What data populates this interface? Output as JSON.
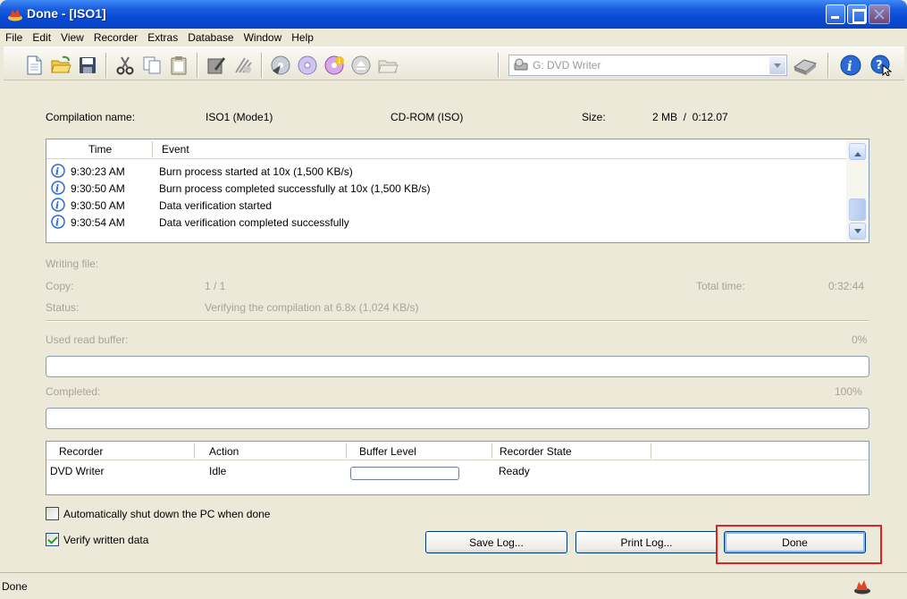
{
  "window": {
    "title": "Done - [ISO1]"
  },
  "menu": [
    "File",
    "Edit",
    "View",
    "Recorder",
    "Extras",
    "Database",
    "Window",
    "Help"
  ],
  "toolbar": {
    "drive_label": "G: DVD Writer",
    "icons": [
      "new-icon",
      "open-icon",
      "save-icon",
      "cut-icon",
      "copy-icon",
      "paste-icon",
      "edit-icon",
      "erase-icon",
      "burn-icon",
      "disc-icon",
      "disc-info-icon",
      "eject-icon",
      "folder-icon",
      "drive-icon",
      "recorder-icon",
      "info-icon",
      "help-icon"
    ]
  },
  "compilation": {
    "name_label": "Compilation name:",
    "name_value": "ISO1 (Mode1)",
    "type": "CD-ROM (ISO)",
    "size_label": "Size:",
    "size_value": "2 MB  /  0:12.07"
  },
  "log": {
    "headers": {
      "time": "Time",
      "event": "Event"
    },
    "rows": [
      {
        "time": "9:30:23 AM",
        "event": "Burn process started at 10x (1,500 KB/s)"
      },
      {
        "time": "9:30:50 AM",
        "event": "Burn process completed successfully at 10x (1,500 KB/s)"
      },
      {
        "time": "9:30:50 AM",
        "event": "Data verification started"
      },
      {
        "time": "9:30:54 AM",
        "event": "Data verification completed successfully"
      }
    ]
  },
  "status": {
    "writing_label": "Writing file:",
    "copy_label": "Copy:",
    "copy_value": "1 / 1",
    "total_time_label": "Total time:",
    "total_time_value": "0:32:44",
    "status_label": "Status:",
    "status_value": "Verifying the compilation at 6.8x (1,024 KB/s)",
    "buffer_label": "Used read buffer:",
    "buffer_value": "0%",
    "buffer_fraction": 0,
    "completed_label": "Completed:",
    "completed_value": "100%",
    "completed_fraction": 1
  },
  "recorder": {
    "headers": {
      "recorder": "Recorder",
      "action": "Action",
      "buffer": "Buffer Level",
      "state": "Recorder State"
    },
    "row": {
      "recorder": "DVD Writer",
      "action": "Idle",
      "buffer_fraction": 0,
      "state": "Ready"
    }
  },
  "options": {
    "shutdown_label": "Automatically shut down the PC when done",
    "shutdown_checked": false,
    "verify_label": "Verify written data",
    "verify_checked": true
  },
  "buttons": {
    "save_log": "Save Log...",
    "print_log": "Print Log...",
    "done": "Done"
  },
  "statusbar": {
    "text": "Done"
  },
  "colors": {
    "titlebar": "#0a4ad6",
    "info_icon": "#2a6ad6",
    "highlight": "#e0231f"
  }
}
